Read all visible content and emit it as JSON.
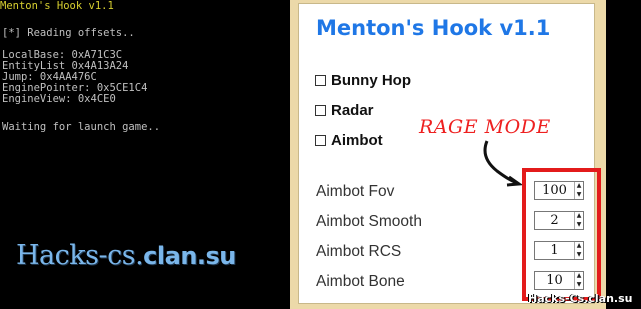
{
  "console": {
    "title": "Menton's Hook v1.1",
    "lines": [
      "[*] Reading offsets..",
      "LocalBase: 0xA71C3C",
      "EntityList 0x4A13A24",
      "Jump: 0x4AA476C",
      "EnginePointer: 0x5CE1C4",
      "EngineView: 0x4CE0",
      "Waiting for launch game.."
    ]
  },
  "watermark_left": {
    "prefix": "Hacks-cs.",
    "suffix": "clan.su"
  },
  "panel": {
    "title": "Menton's Hook v1.1",
    "checkboxes": [
      {
        "label": "Bunny Hop",
        "checked": false
      },
      {
        "label": "Radar",
        "checked": false
      },
      {
        "label": "Aimbot",
        "checked": false
      }
    ],
    "annotation": "RAGE MODE",
    "settings": [
      {
        "label": "Aimbot Fov",
        "value": "100"
      },
      {
        "label": "Aimbot Smooth",
        "value": "2"
      },
      {
        "label": "Aimbot RCS",
        "value": "1"
      },
      {
        "label": "Aimbot Bone",
        "value": "10"
      }
    ]
  },
  "watermark_right": "Hacks-Cs.clan.su",
  "colors": {
    "title_blue": "#1f77e6",
    "highlight_red": "#e31b1b",
    "panel_frame": "#ecd9a9",
    "console_title": "#d8d030"
  }
}
